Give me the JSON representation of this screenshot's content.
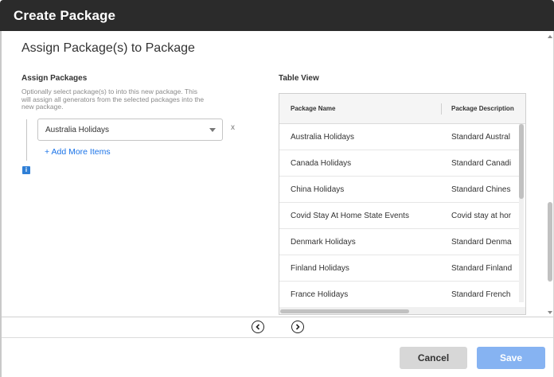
{
  "dialog": {
    "title": "Create Package"
  },
  "page": {
    "heading": "Assign Package(s) to Package"
  },
  "assign": {
    "label": "Assign Packages",
    "help": "Optionally select package(s) to into this new package. This will assign all generators from the selected packages into the new package.",
    "selected_value": "Australia Holidays",
    "remove_label": "x",
    "add_more_label": "+ Add More Items",
    "info_icon_label": "i"
  },
  "table_view": {
    "label": "Table View",
    "columns": [
      "Package Name",
      "Package Description"
    ],
    "rows": [
      {
        "name": "Australia Holidays",
        "description": "Standard Austral"
      },
      {
        "name": "Canada Holidays",
        "description": "Standard Canadi"
      },
      {
        "name": "China Holidays",
        "description": "Standard Chines"
      },
      {
        "name": "Covid Stay At Home State Events",
        "description": "Covid stay at hor"
      },
      {
        "name": "Denmark Holidays",
        "description": "Standard Denma"
      },
      {
        "name": "Finland Holidays",
        "description": "Standard Finland"
      },
      {
        "name": "France Holidays",
        "description": "Standard French"
      }
    ]
  },
  "footer": {
    "prev_icon": "chevron-left-circle-icon",
    "next_icon": "chevron-right-circle-icon",
    "cancel_label": "Cancel",
    "save_label": "Save"
  },
  "colors": {
    "title_bar": "#2b2b2b",
    "link": "#1a73e8",
    "save_button": "#86b3f2",
    "cancel_button": "#d7d7d7"
  }
}
